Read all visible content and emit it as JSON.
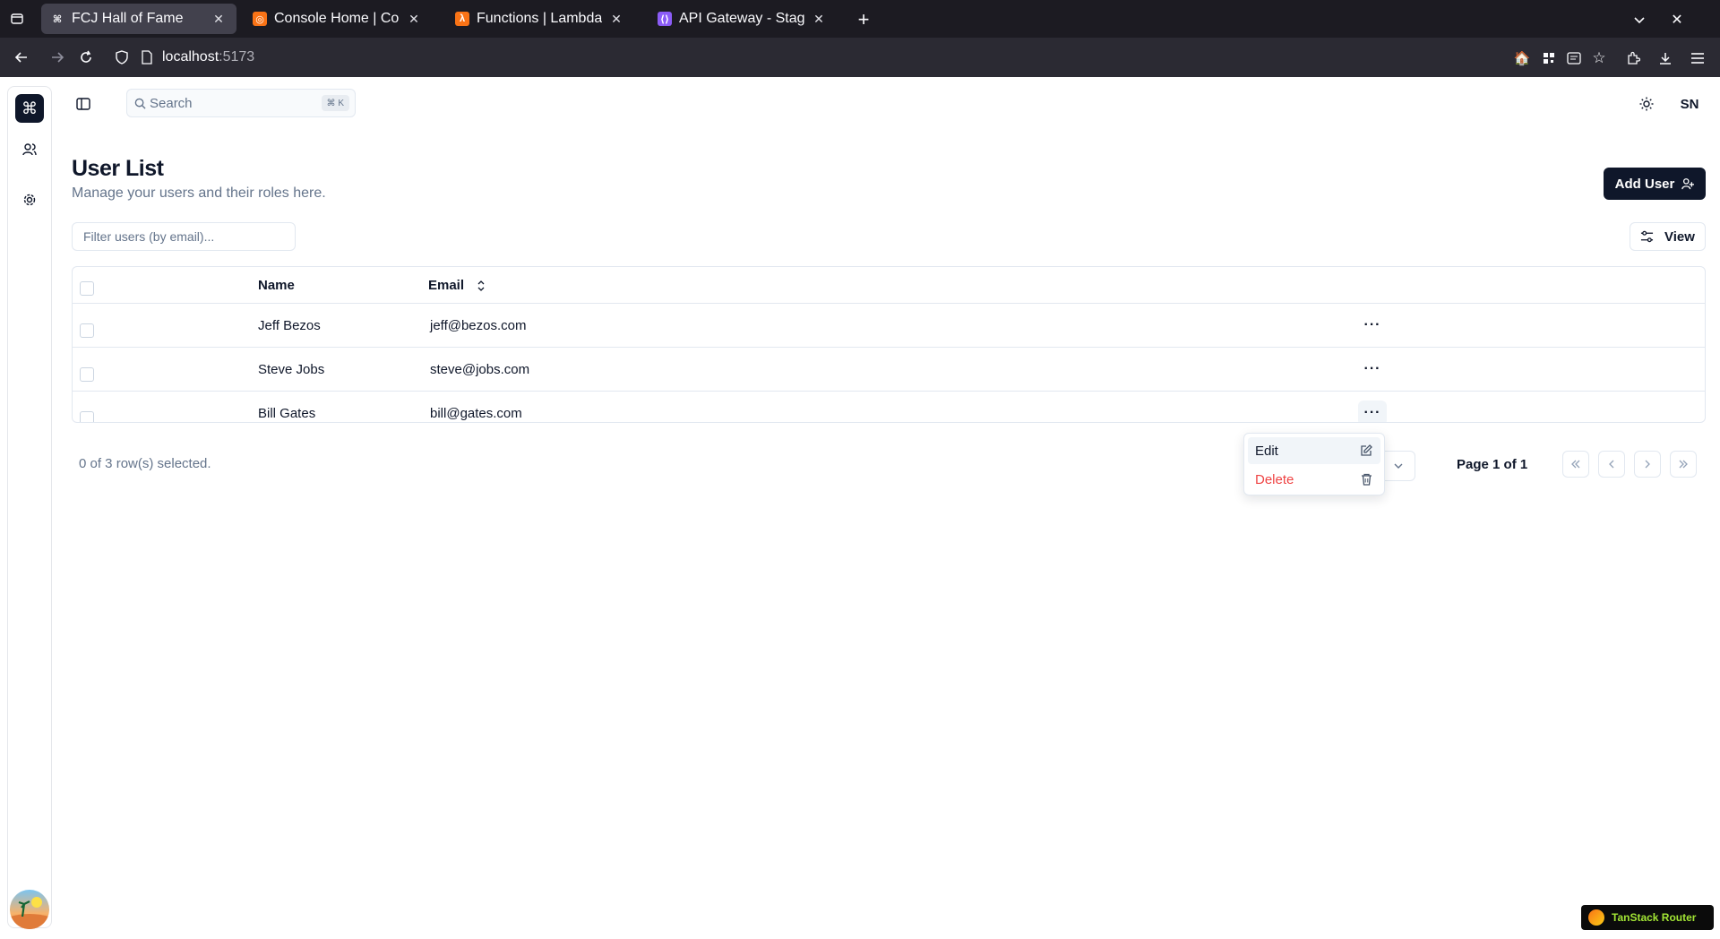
{
  "browser": {
    "tabs": [
      {
        "title": "FCJ Hall of Fame",
        "icon": "command-icon",
        "active": true
      },
      {
        "title": "Console Home | Conso",
        "icon": "aws-console-icon",
        "active": false
      },
      {
        "title": "Functions | Lambda",
        "icon": "lambda-icon",
        "active": false
      },
      {
        "title": "API Gateway - Stages",
        "icon": "api-gateway-icon",
        "active": false
      }
    ],
    "url_host": "localhost",
    "url_port": ":5173"
  },
  "topbar": {
    "search_placeholder": "Search",
    "search_shortcut": "⌘ K",
    "user_initials": "SN"
  },
  "page": {
    "title": "User List",
    "subtitle": "Manage your users and their roles here.",
    "add_user_label": "Add User",
    "filter_placeholder": "Filter users (by email)...",
    "view_label": "View"
  },
  "table": {
    "columns": [
      "Name",
      "Email"
    ],
    "rows": [
      {
        "name": "Jeff Bezos",
        "email": "jeff@bezos.com"
      },
      {
        "name": "Steve Jobs",
        "email": "steve@jobs.com"
      },
      {
        "name": "Bill Gates",
        "email": "bill@gates.com"
      }
    ],
    "actions_label": "···"
  },
  "footer": {
    "selection_text": "0 of 3 row(s) selected.",
    "page_info": "Page 1 of 1"
  },
  "row_menu": {
    "items": [
      {
        "label": "Edit",
        "icon": "edit-icon"
      },
      {
        "label": "Delete",
        "icon": "trash-icon"
      }
    ]
  },
  "devtools_badge": "TanStack Router",
  "colors": {
    "primary": "#0f172a",
    "muted": "#64748b",
    "border": "#e2e8f0",
    "danger": "#ef4444",
    "browser_bg": "#1c1b22"
  }
}
